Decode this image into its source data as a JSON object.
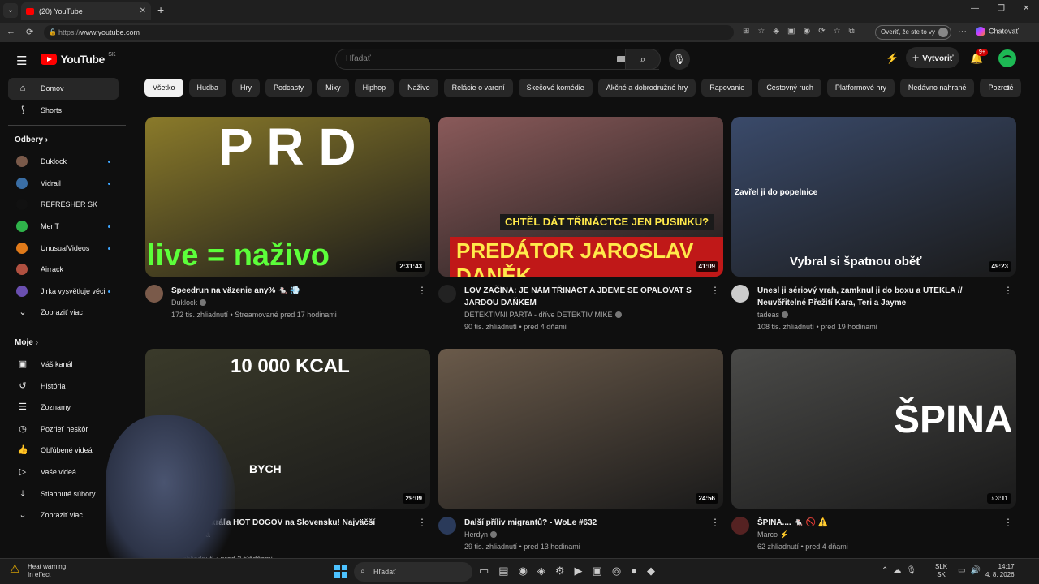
{
  "browser": {
    "tab_title": "(20) YouTube",
    "url_protocol": "https://",
    "url_host": "www.youtube.com",
    "verify_label": "Overiť, že ste to vy",
    "chat_label": "Chatovať"
  },
  "header": {
    "logo": "YouTube",
    "country": "SK",
    "search_placeholder": "Hľadať",
    "create_label": "Vytvoriť",
    "notif_count": "9+"
  },
  "sidebar": {
    "home": "Domov",
    "shorts": "Shorts",
    "subs_heading": "Odbery",
    "subs": [
      {
        "name": "Duklock",
        "color": "#7a5a4a",
        "dot": true
      },
      {
        "name": "Vidrail",
        "color": "#3a6ea5",
        "dot": true
      },
      {
        "name": "REFRESHER SK",
        "color": "#111111",
        "dot": false
      },
      {
        "name": "MenT",
        "color": "#2fb34a",
        "dot": true
      },
      {
        "name": "UnusualVideos",
        "color": "#e07a1a",
        "dot": true
      },
      {
        "name": "Airrack",
        "color": "#b05040",
        "dot": false
      },
      {
        "name": "Jirka vysvětluje věci",
        "color": "#6a4fb0",
        "dot": true
      }
    ],
    "show_more": "Zobraziť viac",
    "me_heading": "Moje",
    "me_items": [
      "Váš kanál",
      "História",
      "Zoznamy",
      "Pozrieť neskôr",
      "Obľúbené videá",
      "Vaše videá",
      "Stiahnuté súbory",
      "Zobraziť viac"
    ]
  },
  "chips": [
    "Všetko",
    "Hudba",
    "Hry",
    "Podcasty",
    "Mixy",
    "Hiphop",
    "Naživo",
    "Relácie o varení",
    "Skečové komédie",
    "Akčné a dobrodružné hry",
    "Rapovanie",
    "Cestovný ruch",
    "Platformové hry",
    "Nedávno nahrané",
    "Pozreté"
  ],
  "videos": [
    {
      "title": "Speedrun na väzenie any% 🐁 💨",
      "channel": "Duklock",
      "stats": "172 tis. zhliadnutí • Streamované pred 17 hodinami",
      "duration": "2:31:43",
      "thumb_top": "P R D",
      "thumb_bottom": "live = naživo",
      "bg": "#8a7a2a",
      "av": "#7a5a4a",
      "verified": true
    },
    {
      "title": "LOV ZAČÍNÁ: JE NÁM TŘINÁCT A JDEME SE OPALOVAT S JARDOU DAŇKEM",
      "channel": "DETEKTIVNÍ PARTA - dříve DETEKTIV MIKE",
      "stats": "90 tis. zhliadnutí • pred 4 dňami",
      "duration": "41:09",
      "thumb_top": "CHTĚL DÁT TŘINÁCTCE JEN PUSINKU?",
      "thumb_bottom": "PREDÁTOR JAROSLAV DANĚK",
      "bg": "#8a5a5a",
      "av": "#222222",
      "verified": true
    },
    {
      "title": "Unesl ji sériový vrah, zamknul ji do boxu a UTEKLA // Neuvěřitelné Přežití Kara, Teri a Jayme",
      "channel": "tadeas",
      "stats": "108 tis. zhliadnutí • pred 19 hodinami",
      "duration": "49:23",
      "thumb_top": "Zavřel ji do popelnice",
      "thumb_bottom": "Vybral si špatnou oběť",
      "bg": "#3a4a6a",
      "av": "#cccccc",
      "verified": true
    },
    {
      "title": "Najväčšie kráľa HOT DOGOV na Slovensku! Najväčší Bratislava",
      "channel": "",
      "stats": "tis. zhliadnutí • pred 2 týždňami",
      "duration": "29:09",
      "thumb_top": "10 000 KCAL",
      "thumb_bottom": "BYCH",
      "bg": "#3a3a2a",
      "av": "#444444",
      "verified": false
    },
    {
      "title": "Další příliv migrantů? - WoLe #632",
      "channel": "Herdyn",
      "stats": "29 tis. zhliadnutí • pred 13 hodinami",
      "duration": "24:56",
      "thumb_top": "",
      "thumb_bottom": "",
      "bg": "#6a5a4a",
      "av": "#2a3a5a",
      "verified": true
    },
    {
      "title": "ŠPINA.... 🐁 🚫 ⚠️",
      "channel": "Marco ⚡",
      "stats": "62 zhliadnutí • pred 4 dňami",
      "duration": "♪ 3:11",
      "thumb_top": "ŠPINA",
      "thumb_bottom": "",
      "bg": "#4a4a48",
      "av": "#552222",
      "verified": false
    }
  ],
  "taskbar": {
    "heat_title": "Heat warning",
    "heat_sub": "In effect",
    "search_label": "Hľadať",
    "lang_top": "SLK",
    "lang_bottom": "SK",
    "time": "14:17",
    "date": "4. 8. 2026"
  }
}
